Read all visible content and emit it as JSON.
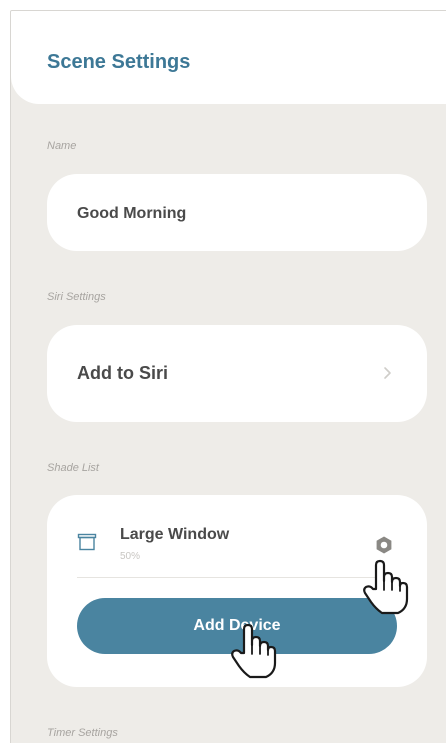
{
  "header": {
    "title": "Scene Settings"
  },
  "name_section": {
    "label": "Name",
    "value": "Good Morning"
  },
  "siri_section": {
    "label": "Siri Settings",
    "action": "Add to Siri"
  },
  "shade_section": {
    "label": "Shade List",
    "items": [
      {
        "name": "Large Window",
        "level": "50%"
      }
    ],
    "add_button": "Add Device"
  },
  "timer_section": {
    "label": "Timer Settings"
  },
  "colors": {
    "accent": "#3d7896",
    "button": "#4a84a0",
    "background": "#eeece8"
  },
  "icons": [
    "chevron-right-icon",
    "shade-icon",
    "gear-icon",
    "hand-pointer-icon"
  ]
}
